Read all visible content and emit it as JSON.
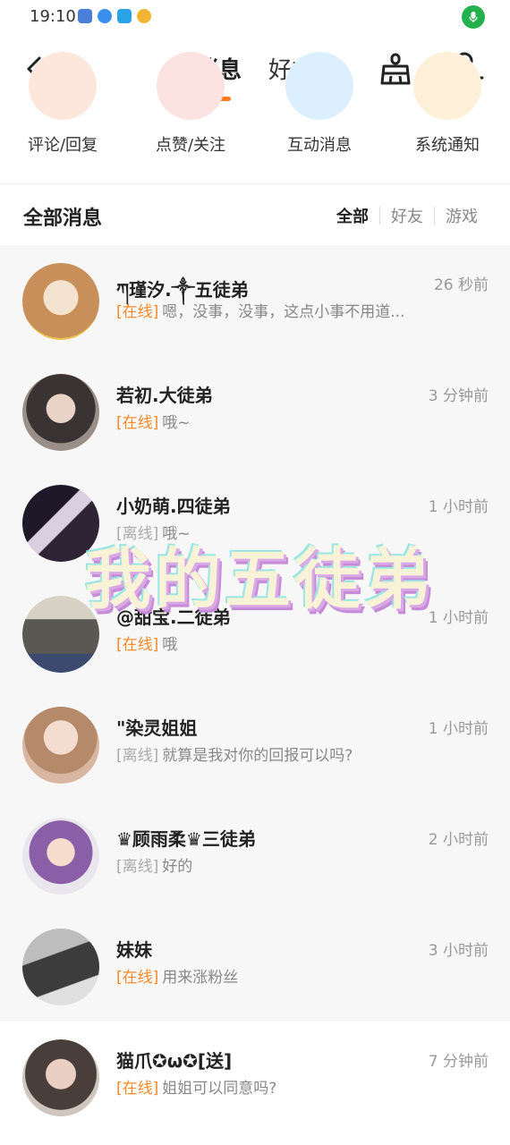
{
  "status_bar": {
    "time": "19:10"
  },
  "nav": {
    "back_icon": "back-arrow-icon",
    "tab_messages": "消息",
    "tab_friends": "好友",
    "accent": "#ff7a1a"
  },
  "quick_actions": [
    {
      "label": "评论/回复",
      "color": "#fde7dc"
    },
    {
      "label": "点赞/关注",
      "color": "#fde2e2"
    },
    {
      "label": "互动消息",
      "color": "#dcefff"
    },
    {
      "label": "系统通知",
      "color": "#fdf0d8"
    }
  ],
  "section": {
    "title": "全部消息",
    "filters": [
      "全部",
      "好友",
      "游戏"
    ]
  },
  "messages": [
    {
      "name": "ཀ瑾汐.༒五徒弟",
      "time": "26 秒前",
      "status": "[在线]",
      "online": true,
      "preview": "嗯，没事，没事，这点小事不用道...",
      "avatar_color": "#c98f5a"
    },
    {
      "name": "若初.大徒弟",
      "time": "3 分钟前",
      "status": "[在线]",
      "online": true,
      "preview": "哦~",
      "avatar_color": "#3a3334"
    },
    {
      "name": "小奶萌.四徒弟",
      "time": "1 小时前",
      "status": "[离线]",
      "online": false,
      "preview": "哦~",
      "avatar_color": "#2e2436"
    },
    {
      "name": "@甜宝.二徒弟",
      "time": "1 小时前",
      "status": "[在线]",
      "online": true,
      "preview": "哦",
      "avatar_color": "#5a5852"
    },
    {
      "name": "\"染灵姐姐",
      "time": "1 小时前",
      "status": "[离线]",
      "online": false,
      "preview": "就算是我对你的回报可以吗?",
      "avatar_color": "#d8b6a2"
    },
    {
      "name": "♛顾雨柔♛三徒弟",
      "time": "2 小时前",
      "status": "[离线]",
      "online": false,
      "preview": "好的",
      "avatar_color": "#8a5fa8"
    },
    {
      "name": "妹妹",
      "time": "3 小时前",
      "status": "[在线]",
      "online": true,
      "preview": "用来涨粉丝",
      "avatar_color": "#3c3c3c"
    },
    {
      "name": "猫爪✪ω✪[送]",
      "time": "7 分钟前",
      "status": "[在线]",
      "online": true,
      "preview": "姐姐可以同意吗?",
      "avatar_color": "#4a3e3a"
    }
  ],
  "overlay_text": "我的五徒弟"
}
